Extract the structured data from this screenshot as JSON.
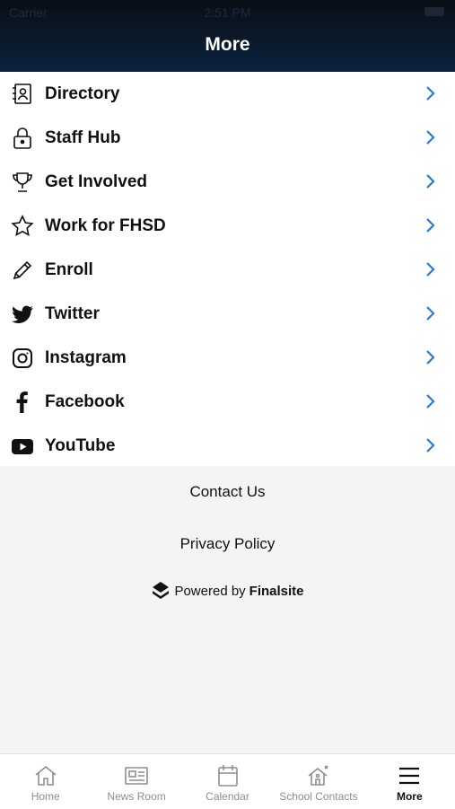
{
  "status": {
    "carrier": "Carrier",
    "time": "2:51 PM"
  },
  "header": {
    "title": "More"
  },
  "menu": [
    {
      "label": "Directory",
      "icon": "directory-icon"
    },
    {
      "label": "Staff Hub",
      "icon": "lock-icon"
    },
    {
      "label": "Get Involved",
      "icon": "trophy-icon"
    },
    {
      "label": "Work for FHSD",
      "icon": "star-icon"
    },
    {
      "label": "Enroll",
      "icon": "pencil-icon"
    },
    {
      "label": "Twitter",
      "icon": "twitter-icon"
    },
    {
      "label": "Instagram",
      "icon": "instagram-icon"
    },
    {
      "label": "Facebook",
      "icon": "facebook-icon"
    },
    {
      "label": "YouTube",
      "icon": "youtube-icon"
    }
  ],
  "footer": {
    "contact": "Contact Us",
    "privacy": "Privacy Policy",
    "powered_prefix": "Powered by",
    "powered_brand": "Finalsite"
  },
  "tabs": [
    {
      "label": "Home",
      "icon": "home-icon"
    },
    {
      "label": "News Room",
      "icon": "newspaper-icon"
    },
    {
      "label": "Calendar",
      "icon": "calendar-icon"
    },
    {
      "label": "School Contacts",
      "icon": "school-contacts-icon"
    },
    {
      "label": "More",
      "icon": "menu-icon",
      "active": true
    }
  ],
  "colors": {
    "accent": "#2a7ad6",
    "header": "#0b1a2c"
  }
}
